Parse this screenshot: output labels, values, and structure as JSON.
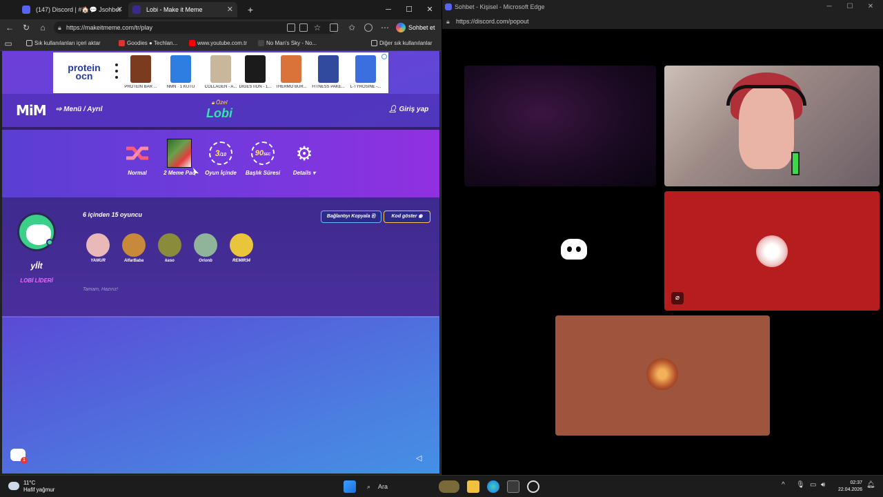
{
  "browser": {
    "tabs": [
      {
        "label": "(147) Discord | #🏠💬 Jsohbet",
        "active": false
      },
      {
        "label": "Lobi - Make it Meme",
        "active": true
      }
    ],
    "new_tab": "+",
    "url": "https://makeitmeme.com/tr/play",
    "chat_button": "Sohbet et",
    "bookmarks": [
      "Sık kullanılanları içeri aktar",
      "Goodies ● Techlan...",
      "www.youtube.com.tr",
      "No Man's Sky - No..."
    ],
    "other_favorites": "Diğer sık kullanılanlar"
  },
  "ad": {
    "brand": "protein ocn",
    "products": [
      {
        "caption": "PROTEIN BAR ...",
        "color": "#7a3b1f"
      },
      {
        "caption": "NMN · 1 KUTU",
        "color": "#2d7ee0"
      },
      {
        "caption": "COLLAGEN - A...",
        "color": "#c8b79a"
      },
      {
        "caption": "DIGESTION - 1...",
        "color": "#1b1b1b"
      },
      {
        "caption": "THERMO BUR...",
        "color": "#d9733a"
      },
      {
        "caption": "FITNESS PAKE...",
        "color": "#324a9e"
      },
      {
        "caption": "L-TYROSINE -...",
        "color": "#3b6fe0"
      }
    ]
  },
  "site": {
    "logo": "MiM",
    "menu": "Menü / Ayrıl",
    "lobby_tag": "Özel",
    "lobby_title": "Lobi",
    "login": "Giriş yap"
  },
  "settings": {
    "mode": "Normal",
    "pack": "2 Meme Pac",
    "rounds_value": "3",
    "rounds_max": "/10",
    "rounds_label": "Oyun İçinde",
    "timer_value": "90",
    "timer_unit": "SEC",
    "timer_label": "Başlık Süresi",
    "details": "Details"
  },
  "lobby": {
    "host_name": "yİİt",
    "host_role": "LOBİ LİDERİ",
    "player_count": "6 içinden 15 oyuncu",
    "copy_link": "Bağlantıyı Kopyala",
    "show_code": "Kod göster",
    "players": [
      {
        "name": "YAMUR",
        "color": "#e9b9b9"
      },
      {
        "name": "AlfarBaba",
        "color": "#c88a3a"
      },
      {
        "name": "kaso",
        "color": "#8a8b3b"
      },
      {
        "name": "Orionb",
        "color": "#8fb49a"
      },
      {
        "name": "REMIR34",
        "color": "#e8c53a"
      }
    ],
    "waiting_text": "Tamam, Hazırız!",
    "chat_badge": "1"
  },
  "discord": {
    "window_title": "Sohbet - Kişisel - Microsoft Edge",
    "url": "https://discord.com/popout",
    "tile_colors": {
      "v4": "#b51d1f",
      "v5": "#9e543d"
    }
  },
  "taskbar": {
    "temperature": "11°C",
    "weather": "Hafif yağmur",
    "search": "Ara",
    "time": "02:37",
    "date": "22.04.2026"
  }
}
